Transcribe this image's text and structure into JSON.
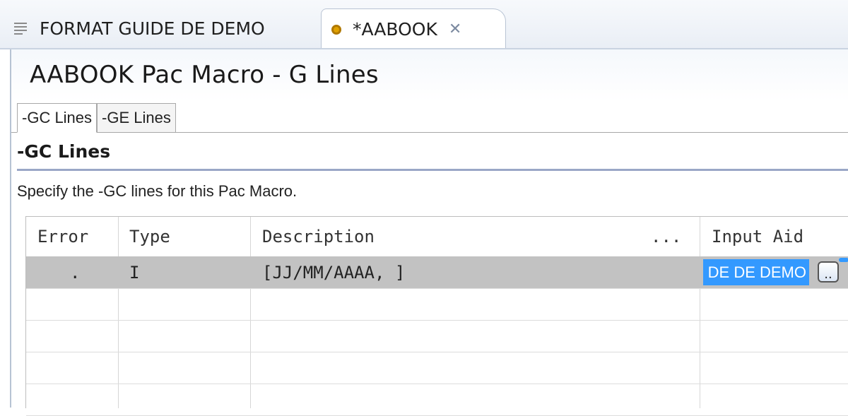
{
  "editor_tabs": {
    "inactive_label": "FORMAT GUIDE DE DEMO",
    "active_label": "*AABOOK",
    "close_glyph": "✕"
  },
  "page": {
    "title": "AABOOK Pac Macro - G Lines"
  },
  "sub_tabs": [
    {
      "label": "-GC Lines",
      "active": true
    },
    {
      "label": "-GE Lines",
      "active": false
    }
  ],
  "section": {
    "title": "-GC Lines",
    "description": "Specify the -GC lines for this Pac Macro."
  },
  "table": {
    "headers": {
      "error": "Error",
      "type": "Type",
      "description": "Description",
      "description_more": "...",
      "input_aid": "Input Aid"
    },
    "rows": [
      {
        "error": ".",
        "type": "I",
        "description": "[JJ/MM/AAAA, ]",
        "input_aid": "DE DE DEMO",
        "browse": "..",
        "selected": true
      }
    ],
    "empty_rows": 4
  },
  "colors": {
    "selection": "#3399ff",
    "row_selected": "#c2c2c2",
    "section_rule": "#9aa7c7"
  },
  "icons": {
    "inactive_tab": "document-lines-icon",
    "active_tab": "gear-icon",
    "close": "close-icon",
    "browse": "ellipsis-button-icon"
  }
}
